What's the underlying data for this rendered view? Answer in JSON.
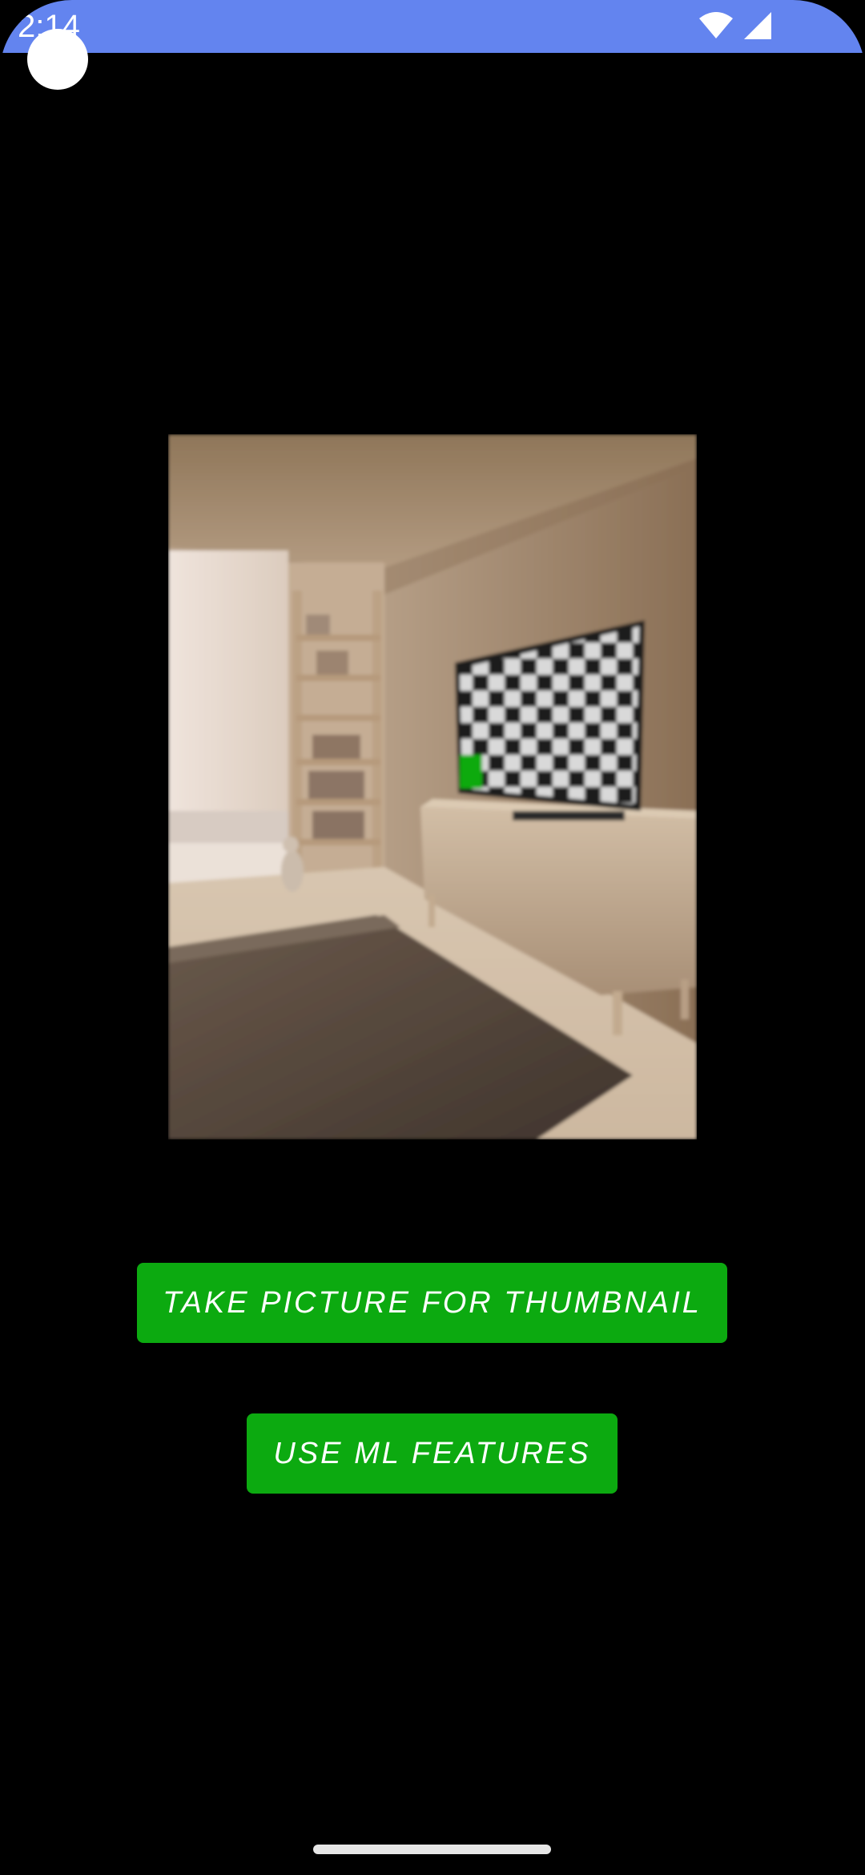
{
  "status_bar": {
    "time": "2:14",
    "background_color": "#6384ef",
    "icons": [
      "wifi-icon",
      "cell-signal-icon"
    ]
  },
  "thumbnail": {
    "icon": "room-thumbnail-image",
    "checker_dark": "#1a1a1a",
    "checker_light": "#d9d9d9",
    "marker_color": "#0caa10"
  },
  "buttons": {
    "take_picture_label": "TAKE PICTURE FOR THUMBNAIL",
    "ml_features_label": "USE ML FEATURES",
    "color": "#0caa10"
  }
}
